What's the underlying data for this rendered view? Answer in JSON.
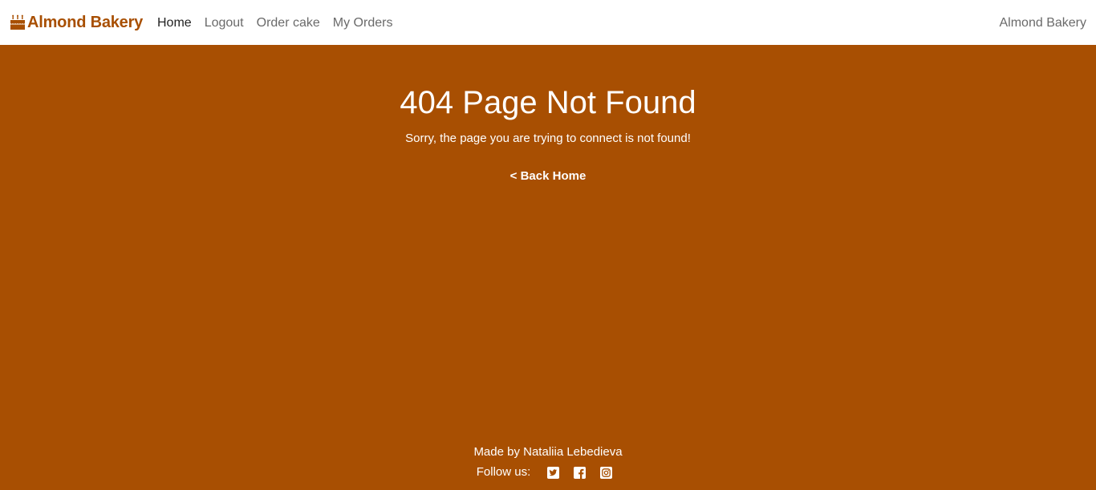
{
  "navbar": {
    "brand": {
      "icon": "birthday-cake-icon",
      "label": "Almond Bakery",
      "color": "#a84f02"
    },
    "links": [
      {
        "label": "Home",
        "active": true
      },
      {
        "label": "Logout",
        "active": false
      },
      {
        "label": "Order cake",
        "active": false
      },
      {
        "label": "My Orders",
        "active": false
      }
    ],
    "right_text": "Almond Bakery"
  },
  "main": {
    "title": "404 Page Not Found",
    "subtitle": "Sorry, the page you are trying to connect is not found!",
    "back_link": "< Back Home",
    "background_color": "#a84f02"
  },
  "footer": {
    "made_by": "Made by Nataliia Lebedieva",
    "follow_label": "Follow us:",
    "social_icons": [
      "twitter-icon",
      "facebook-icon",
      "instagram-icon"
    ]
  }
}
